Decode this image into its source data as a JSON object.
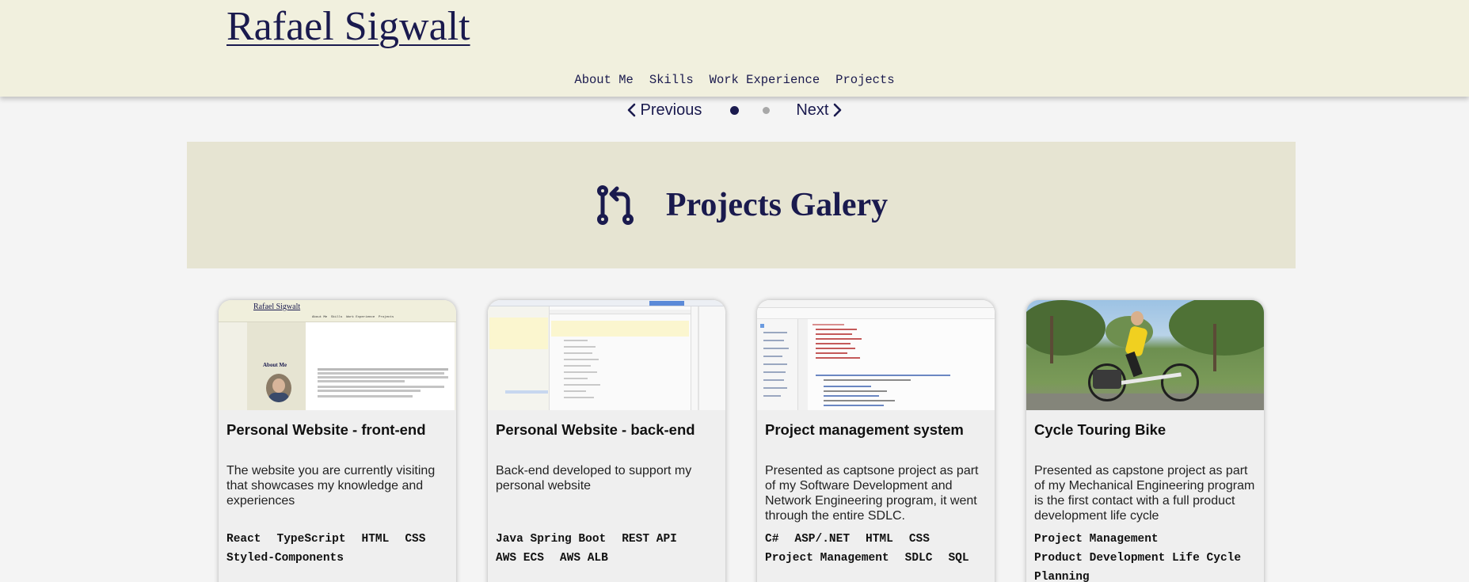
{
  "header": {
    "logo": "Rafael Sigwalt",
    "nav": [
      "About Me",
      "Skills",
      "Work Experience",
      "Projects"
    ]
  },
  "carousel": {
    "previous": "Previous",
    "next": "Next",
    "active_slide": 1,
    "slide_count": 2
  },
  "banner": {
    "icon": "git-pull-request-icon",
    "title": "Projects Galery"
  },
  "cards": [
    {
      "title": "Personal Website - front-end",
      "description": "The website you are currently visiting that showcases my knowledge and experiences",
      "tags": [
        "React",
        "TypeScript",
        "HTML",
        "CSS",
        "Styled-Components"
      ],
      "thumbnail": {
        "site_title": "Rafael Sigwalt",
        "nav": "About Me  Skills  Work Experience  Projects",
        "heading": "About Me"
      }
    },
    {
      "title": "Personal Website - back-end",
      "description": "Back-end developed to support my personal website",
      "tags": [
        "Java Spring Boot",
        "REST API",
        "AWS ECS",
        "AWS ALB"
      ]
    },
    {
      "title": "Project management system",
      "description": "Presented as captsone project as part of my Software Development and Network Engineering program, it went through the entire SDLC.",
      "tags": [
        "C#",
        "ASP/.NET",
        "HTML",
        "CSS",
        "Project Management",
        "SDLC",
        "SQL"
      ]
    },
    {
      "title": "Cycle Touring Bike",
      "description": "Presented as capstone project as part of my Mechanical Engineering program is the first contact with a full product development life cycle",
      "tags": [
        "Project Management",
        "Product Development Life Cycle",
        "Planning"
      ]
    }
  ],
  "colors": {
    "header_bg": "#f1f0de",
    "banner_bg": "#e6e4d2",
    "accent": "#1a1a4e",
    "page_bg": "#f4f4f4"
  }
}
